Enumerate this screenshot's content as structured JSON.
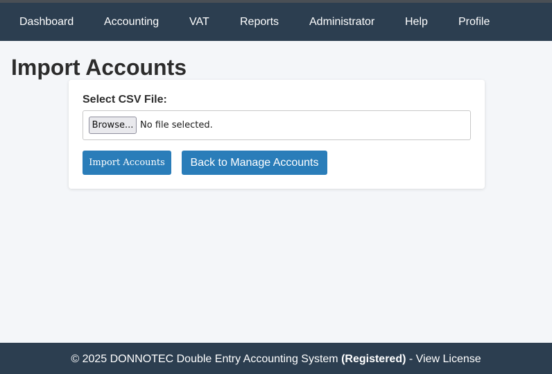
{
  "nav": {
    "items": [
      {
        "label": "Dashboard"
      },
      {
        "label": "Accounting"
      },
      {
        "label": "VAT"
      },
      {
        "label": "Reports"
      },
      {
        "label": "Administrator"
      },
      {
        "label": "Help"
      },
      {
        "label": "Profile"
      }
    ]
  },
  "page": {
    "title": "Import Accounts"
  },
  "form": {
    "csv_label": "Select CSV File:",
    "browse_label": "Browse...",
    "file_status": "No file selected.",
    "import_button": "Import Accounts",
    "back_button": "Back to Manage Accounts"
  },
  "footer": {
    "copyright": "© 2025 DONNOTEC Double Entry Accounting System",
    "registered": "(Registered)",
    "separator": "-",
    "license_link": "View License"
  },
  "colors": {
    "nav_bg": "#2c3e50",
    "page_bg": "#f4f6f9",
    "button_primary": "#2a7db9"
  }
}
